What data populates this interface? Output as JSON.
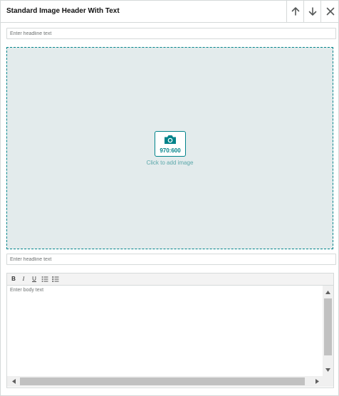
{
  "module": {
    "title": "Standard Image Header With Text"
  },
  "header_actions": {
    "move_up_icon": "arrow-up-icon",
    "move_down_icon": "arrow-down-icon",
    "remove_icon": "close-icon"
  },
  "headline_top": {
    "placeholder": "Enter headline text",
    "value": ""
  },
  "image": {
    "ratio_label": "970:600",
    "add_label": "Click to add image",
    "icon": "camera-icon",
    "accent_color": "#00838a",
    "background_color": "#e3ebec"
  },
  "headline_bottom": {
    "placeholder": "Enter headline text",
    "value": ""
  },
  "editor": {
    "toolbar": {
      "bold": "B",
      "italic": "I",
      "underline": "U",
      "bullet_list_icon": "bullet-list-icon",
      "numbered_list_icon": "numbered-list-icon"
    },
    "body_placeholder": "Enter body text",
    "body_value": ""
  }
}
